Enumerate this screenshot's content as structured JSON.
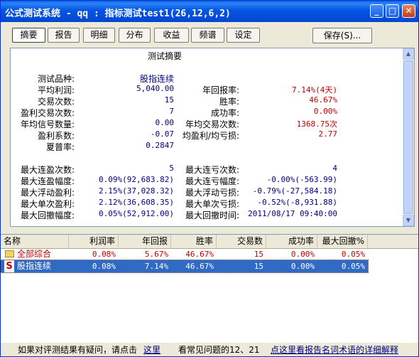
{
  "window": {
    "title": "公式测试系统 - qq : 指标测试test1(26,12,6,2)"
  },
  "title_buttons": {
    "minimize": "_",
    "maximize": "□",
    "close": "✕"
  },
  "tabs": [
    "摘要",
    "报告",
    "明细",
    "分布",
    "收益",
    "频谱",
    "设定"
  ],
  "active_tab": "摘要",
  "save_button": "保存(S)...",
  "summary": {
    "heading": "测试摘要",
    "left": [
      {
        "label": "测试品种:",
        "value": "股指连续"
      },
      {
        "label": "平均利润:",
        "value": "5,040.00"
      },
      {
        "label": "交易次数:",
        "value": "15"
      },
      {
        "label": "盈利交易次数:",
        "value": "7"
      },
      {
        "label": "年均信号数量:",
        "value": "0.00"
      },
      {
        "label": "盈利系数:",
        "value": "-0.07"
      },
      {
        "label": "夏普率:",
        "value": "0.2847"
      }
    ],
    "right": [
      {
        "label": "年回报率:",
        "value": "7.14%(4天)"
      },
      {
        "label": "胜率:",
        "value": "46.67%"
      },
      {
        "label": "成功率:",
        "value": "0.00%"
      },
      {
        "label": "年均交易次数:",
        "value": "1368.75次"
      },
      {
        "label": "均盈利/均亏损:",
        "value": "2.77"
      }
    ],
    "left2": [
      {
        "label": "最大连盈次数:",
        "value": "5"
      },
      {
        "label": "最大连盈幅度:",
        "value": "0.09%(92,683.82)"
      },
      {
        "label": "最大浮动盈利:",
        "value": "2.15%(37,028.32)"
      },
      {
        "label": "最大单次盈利:",
        "value": "2.12%(36,608.35)"
      },
      {
        "label": "最大回撤幅度:",
        "value": "0.05%(52,912.00)"
      }
    ],
    "right2": [
      {
        "label": "最大连亏次数:",
        "value": "4"
      },
      {
        "label": "最大连亏幅度:",
        "value": "-0.00%(-563.99)"
      },
      {
        "label": "最大浮动亏损:",
        "value": "-0.79%(-27,584.18)"
      },
      {
        "label": "最大单次亏损:",
        "value": "-0.52%(-8,931.88)"
      },
      {
        "label": "最大回撤时间:",
        "value": "2011/08/17 09:40:00"
      }
    ]
  },
  "table": {
    "columns": [
      "名称",
      "利润率",
      "年回报",
      "胜率",
      "交易数",
      "成功率",
      "最大回撤%"
    ],
    "rows": [
      {
        "name": "全部综合",
        "icon": "folder-icon",
        "values": [
          "0.08%",
          "5.67%",
          "46.67%",
          "15",
          "0.00%",
          "0.05%"
        ],
        "selected": false
      },
      {
        "name": "股指连续",
        "icon": "s-icon",
        "values": [
          "0.08%",
          "7.14%",
          "46.67%",
          "15",
          "0.00%",
          "0.05%"
        ],
        "selected": true
      }
    ]
  },
  "footer": {
    "prefix": "如果对评测结果有疑问，请点击",
    "link1": "这里",
    "middle": "看常见问题的12、21",
    "link2": "点这里看报告名词术语的详细解释"
  },
  "colors": {
    "title_blue": "#0554e3",
    "value_blue": "#000080",
    "value_red": "#c00000",
    "selection": "#316ac5"
  }
}
